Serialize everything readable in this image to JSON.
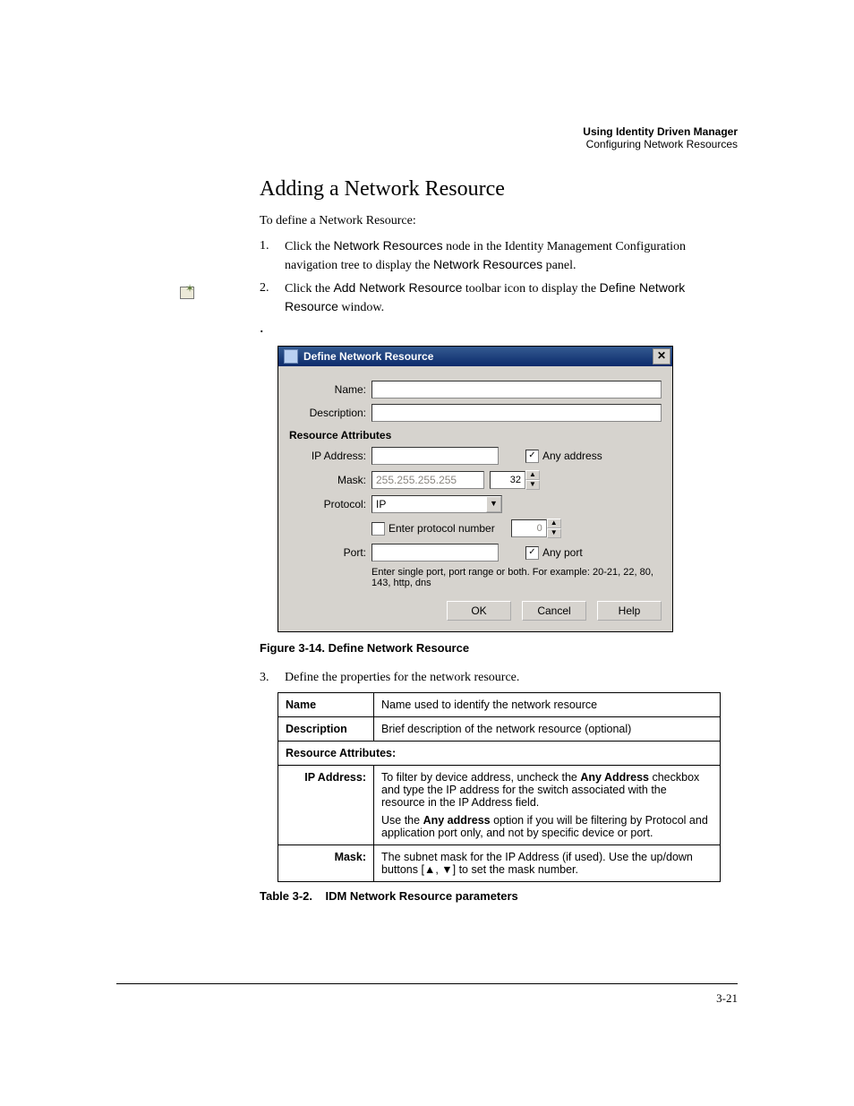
{
  "header": {
    "title": "Using Identity Driven Manager",
    "subtitle": "Configuring Network Resources"
  },
  "section_heading": "Adding a Network Resource",
  "intro": "To define a Network Resource:",
  "steps": {
    "s1_num": "1.",
    "s1_a": "Click the ",
    "s1_b": "Network Resources",
    "s1_c": " node in the Identity Management Configuration navigation tree to display the ",
    "s1_d": "Network Resources",
    "s1_e": " panel.",
    "s2_num": "2.",
    "s2_a": "Click the ",
    "s2_b": "Add Network Resource",
    "s2_c": " toolbar icon to display the ",
    "s2_d": "Define Network Resource",
    "s2_e": " window.",
    "s3_num": "3.",
    "s3": "Define the properties for the network resource."
  },
  "dialog": {
    "title": "Define Network Resource",
    "labels": {
      "name": "Name:",
      "description": "Description:",
      "section": "Resource Attributes",
      "ip": "IP Address:",
      "any_addr": "Any address",
      "mask": "Mask:",
      "mask_val": "255.255.255.255",
      "mask_spin": "32",
      "protocol": "Protocol:",
      "protocol_val": "IP",
      "enter_proto": "Enter protocol number",
      "proto_spin": "0",
      "port": "Port:",
      "any_port": "Any port",
      "port_help": "Enter single port, port range or both. For example: 20-21, 22, 80, 143, http, dns"
    },
    "buttons": {
      "ok": "OK",
      "cancel": "Cancel",
      "help": "Help"
    }
  },
  "figure_caption": "Figure 3-14. Define Network Resource",
  "table": {
    "r1k": "Name",
    "r1v": "Name used to identify the network resource",
    "r2k": "Description",
    "r2v": "Brief description of the network resource (optional)",
    "r3": "Resource Attributes:",
    "r4k": "IP Address:",
    "r4v1a": "To filter by device address, uncheck the ",
    "r4v1b": "Any Address",
    "r4v1c": " checkbox and type the IP address for the switch associated with the resource in the IP Address field.",
    "r4v2a": "Use the ",
    "r4v2b": "Any address",
    "r4v2c": " option if you will be filtering by Protocol and application port only, and not by specific device or port.",
    "r5k": "Mask:",
    "r5v": "The subnet mask for the IP Address (if used). Use the up/down buttons [▲, ▼] to set the mask number."
  },
  "table_caption": {
    "num": "Table 3-2.",
    "title": "IDM Network Resource parameters"
  },
  "page_number": "3-21"
}
